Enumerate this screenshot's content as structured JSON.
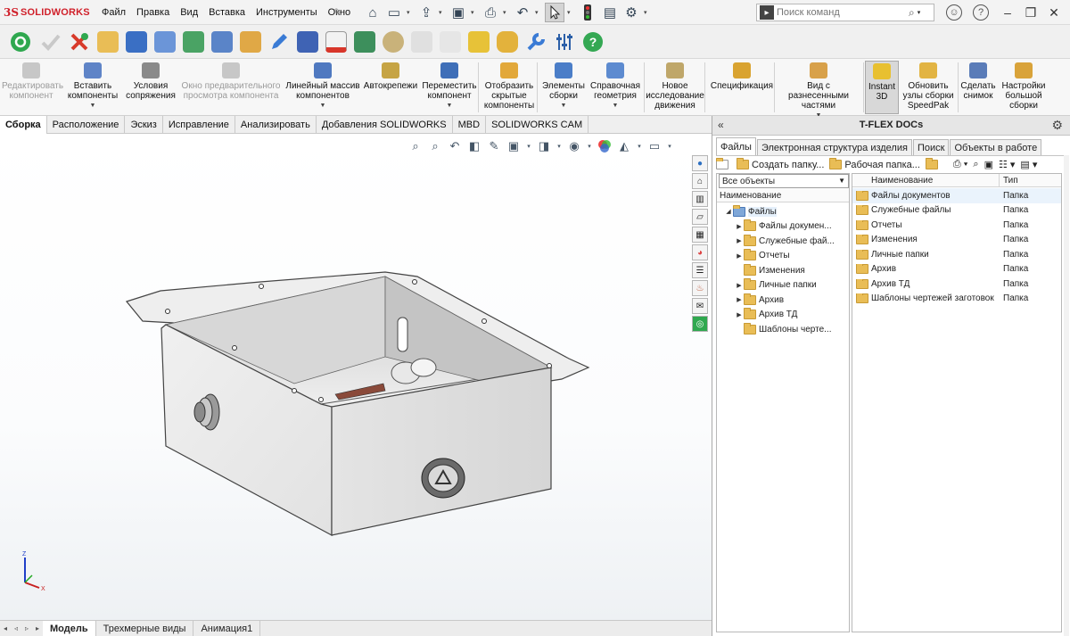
{
  "app": {
    "logo_ds": "3S",
    "logo_text": "SOLIDWORKS",
    "menus": [
      "Файл",
      "Правка",
      "Вид",
      "Вставка",
      "Инструменты",
      "Окно"
    ],
    "search_placeholder": "Поиск команд"
  },
  "command_manager": {
    "buttons": [
      {
        "label": "Редактировать\nкомпонент",
        "disabled": true
      },
      {
        "label": "Вставить\nкомпоненты"
      },
      {
        "label": "Условия\nсопряжения"
      },
      {
        "label": "Окно предварительного\nпросмотра компонента",
        "disabled": true
      },
      {
        "label": "Линейный массив\nкомпонентов"
      },
      {
        "label": "Автокрепежи"
      },
      {
        "label": "Переместить\nкомпонент"
      },
      {
        "label": "Отобразить\nскрытые\nкомпоненты"
      },
      {
        "label": "Элементы\nсборки"
      },
      {
        "label": "Справочная\nгеометрия"
      },
      {
        "label": "Новое\nисследование\nдвижения"
      },
      {
        "label": "Спецификация"
      },
      {
        "label": "Вид с разнесенными\nчастями"
      },
      {
        "label": "Instant\n3D",
        "active": true
      },
      {
        "label": "Обновить\nузлы сборки\nSpeedPak"
      },
      {
        "label": "Сделать\nснимок"
      },
      {
        "label": "Настройки\nбольшой\nсборки"
      }
    ]
  },
  "tabs": [
    "Сборка",
    "Расположение",
    "Эскиз",
    "Исправление",
    "Анализировать",
    "Добавления SOLIDWORKS",
    "MBD",
    "SOLIDWORKS CAM"
  ],
  "bottom_tabs": [
    "Модель",
    "Трехмерные виды",
    "Анимация1"
  ],
  "triad": {
    "z": "Z",
    "x": "X"
  },
  "panel": {
    "title": "T-FLEX DOCs",
    "tabs": [
      "Файлы",
      "Электронная структура изделия",
      "Поиск",
      "Объекты в работе"
    ],
    "toolbar": {
      "create_folder": "Создать папку...",
      "work_folder": "Рабочая папка..."
    },
    "filter": "Все объекты",
    "tree_header": "Наименование",
    "tree_root": "Файлы",
    "tree_items": [
      {
        "label": "Файлы докумен...",
        "expandable": true
      },
      {
        "label": "Служебные фай...",
        "expandable": true
      },
      {
        "label": "Отчеты",
        "expandable": true
      },
      {
        "label": "Изменения",
        "expandable": false
      },
      {
        "label": "Личные папки",
        "expandable": true
      },
      {
        "label": "Архив",
        "expandable": true
      },
      {
        "label": "Архив ТД",
        "expandable": true
      },
      {
        "label": "Шаблоны черте...",
        "expandable": false
      }
    ],
    "list_headers": {
      "name": "Наименование",
      "type": "Тип"
    },
    "list_rows": [
      {
        "name": "Файлы документов",
        "type": "Папка"
      },
      {
        "name": "Служебные файлы",
        "type": "Папка"
      },
      {
        "name": "Отчеты",
        "type": "Папка"
      },
      {
        "name": "Изменения",
        "type": "Папка"
      },
      {
        "name": "Личные папки",
        "type": "Папка"
      },
      {
        "name": "Архив",
        "type": "Папка"
      },
      {
        "name": "Архив ТД",
        "type": "Папка"
      },
      {
        "name": "Шаблоны чертежей заготовок",
        "type": "Папка"
      }
    ]
  },
  "colors": {
    "brand": "#d0202a",
    "accent": "#3a7bd5",
    "folder": "#e9bd56",
    "selection": "#e5f0fb"
  }
}
